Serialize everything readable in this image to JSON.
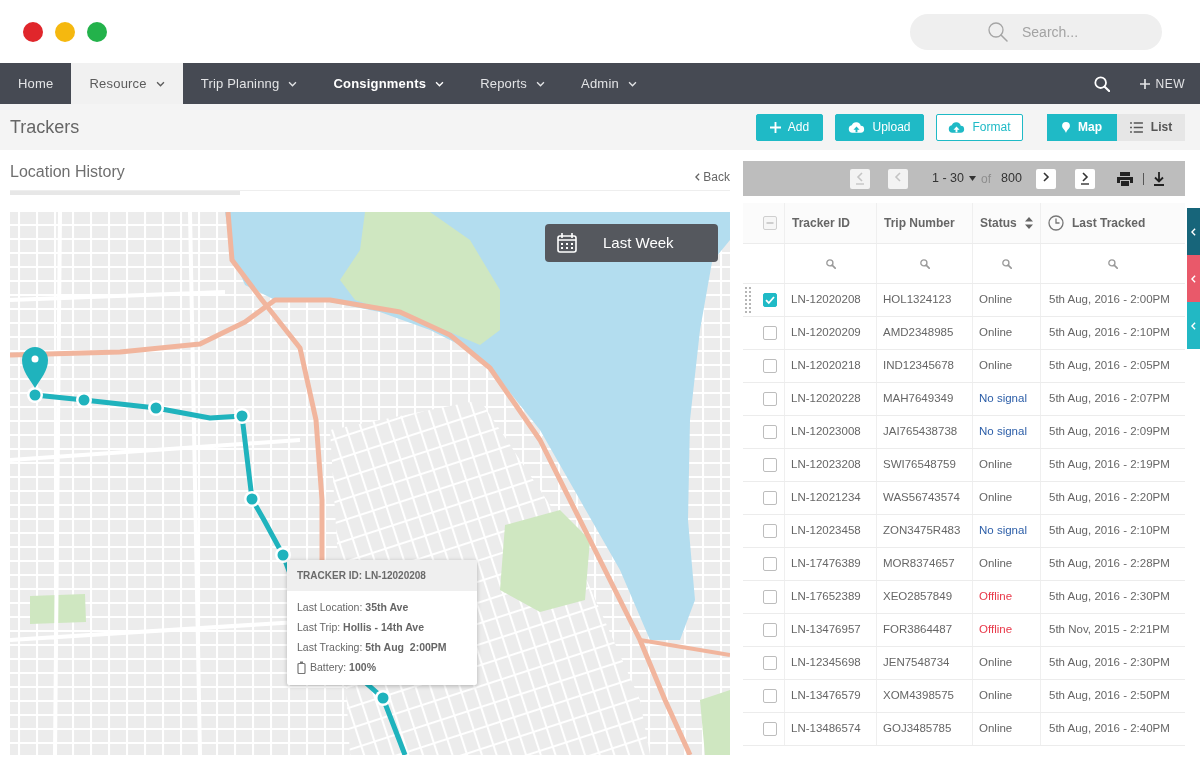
{
  "window": {
    "controls": [
      {
        "color": "#e0262b"
      },
      {
        "color": "#f5b80f"
      },
      {
        "color": "#23b24b"
      }
    ]
  },
  "search": {
    "placeholder": "Search..."
  },
  "nav": {
    "items": [
      {
        "label": "Home",
        "selected": false,
        "menu": false,
        "bold": false
      },
      {
        "label": "Resource",
        "selected": true,
        "menu": true,
        "bold": false
      },
      {
        "label": "Trip Planinng",
        "selected": false,
        "menu": true,
        "bold": false
      },
      {
        "label": "Consignments",
        "selected": false,
        "menu": true,
        "bold": true
      },
      {
        "label": "Reports",
        "selected": false,
        "menu": true,
        "bold": false
      },
      {
        "label": "Admin",
        "selected": false,
        "menu": true,
        "bold": false
      }
    ],
    "new_label": "NEW"
  },
  "page": {
    "title": "Trackers",
    "buttons": [
      {
        "label": "Add",
        "kind": "add",
        "outline": false
      },
      {
        "label": "Upload",
        "kind": "upload",
        "outline": false
      },
      {
        "label": "Format",
        "kind": "format",
        "outline": true
      }
    ],
    "views": [
      {
        "label": "Map",
        "kind": "map",
        "selected": true
      },
      {
        "label": "List",
        "kind": "list",
        "selected": false
      }
    ]
  },
  "location_history": {
    "title": "Location History",
    "back": "Back",
    "date_filter": "Last Week",
    "tooltip": {
      "title": "TRACKER ID: LN-12020208",
      "lines": [
        "Last Location: **35th Ave**",
        "Last Trip: **Hollis - 14th Ave**",
        "Last Tracking: **5th Aug  2:00PM**"
      ],
      "battery": "Battery: **100%**"
    }
  },
  "pagination": {
    "range": "1 - 30",
    "of": "of",
    "total": "800",
    "first_disabled": true,
    "prev_disabled": true,
    "next_disabled": false,
    "last_disabled": false
  },
  "table": {
    "select_all": {
      "indeterminate": true
    },
    "columns": [
      {
        "label": "Tracker ID",
        "kind": "plain"
      },
      {
        "label": "Trip Number",
        "kind": "plain"
      },
      {
        "label": "Status",
        "kind": "sort"
      },
      {
        "label": "Last Tracked",
        "kind": "time"
      }
    ],
    "rows": [
      {
        "tracker_id": "LN-12020208",
        "trip_number": "HOL1324123",
        "status": {
          "text": "Online",
          "color": "#666666"
        },
        "last_tracked": "5th Aug, 2016 - 2:00PM",
        "checked": true,
        "hovered": true
      },
      {
        "tracker_id": "LN-12020209",
        "trip_number": "AMD2348985",
        "status": {
          "text": "Online",
          "color": "#666666"
        },
        "last_tracked": "5th Aug, 2016 - 2:10PM",
        "checked": false,
        "hovered": false
      },
      {
        "tracker_id": "LN-12020218",
        "trip_number": "IND12345678",
        "status": {
          "text": "Online",
          "color": "#666666"
        },
        "last_tracked": "5th Aug, 2016 - 2:05PM",
        "checked": false,
        "hovered": false
      },
      {
        "tracker_id": "LN-12020228",
        "trip_number": "MAH7649349",
        "status": {
          "text": "No signal",
          "color": "#2c5ea8"
        },
        "last_tracked": "5th Aug, 2016 - 2:07PM",
        "checked": false,
        "hovered": false
      },
      {
        "tracker_id": "LN-12023008",
        "trip_number": "JAI765438738",
        "status": {
          "text": "No signal",
          "color": "#2c5ea8"
        },
        "last_tracked": "5th Aug, 2016 - 2:09PM",
        "checked": false,
        "hovered": false
      },
      {
        "tracker_id": "LN-12023208",
        "trip_number": "SWI76548759",
        "status": {
          "text": "Online",
          "color": "#666666"
        },
        "last_tracked": "5th Aug, 2016 - 2:19PM",
        "checked": false,
        "hovered": false
      },
      {
        "tracker_id": "LN-12021234",
        "trip_number": "WAS56743574",
        "status": {
          "text": "Online",
          "color": "#666666"
        },
        "last_tracked": "5th Aug, 2016 - 2:20PM",
        "checked": false,
        "hovered": false
      },
      {
        "tracker_id": "LN-12023458",
        "trip_number": "ZON3475R483",
        "status": {
          "text": "No signal",
          "color": "#2c5ea8"
        },
        "last_tracked": "5th Aug, 2016 - 2:10PM",
        "checked": false,
        "hovered": false
      },
      {
        "tracker_id": "LN-17476389",
        "trip_number": "MOR8374657",
        "status": {
          "text": "Online",
          "color": "#666666"
        },
        "last_tracked": "5th Aug, 2016 - 2:28PM",
        "checked": false,
        "hovered": false
      },
      {
        "tracker_id": "LN-17652389",
        "trip_number": "XEO2857849",
        "status": {
          "text": "Offline",
          "color": "#e8394a"
        },
        "last_tracked": "5th Aug, 2016 - 2:30PM",
        "checked": false,
        "hovered": false
      },
      {
        "tracker_id": "LN-13476957",
        "trip_number": "FOR3864487",
        "status": {
          "text": "Offline",
          "color": "#e8394a"
        },
        "last_tracked": "5th Nov, 2015 - 2:21PM",
        "checked": false,
        "hovered": false
      },
      {
        "tracker_id": "LN-12345698",
        "trip_number": "JEN7548734",
        "status": {
          "text": "Online",
          "color": "#666666"
        },
        "last_tracked": "5th Aug, 2016 - 2:30PM",
        "checked": false,
        "hovered": false
      },
      {
        "tracker_id": "LN-13476579",
        "trip_number": "XOM4398575",
        "status": {
          "text": "Online",
          "color": "#666666"
        },
        "last_tracked": "5th Aug, 2016 - 2:50PM",
        "checked": false,
        "hovered": false
      },
      {
        "tracker_id": "LN-13486574",
        "trip_number": "GOJ3485785",
        "status": {
          "text": "Online",
          "color": "#666666"
        },
        "last_tracked": "5th Aug, 2016 - 2:40PM",
        "checked": false,
        "hovered": false
      }
    ]
  },
  "side_tabs": [
    {
      "color": "#17657a"
    },
    {
      "color": "#e9596a"
    },
    {
      "color": "#22b8c4"
    }
  ]
}
